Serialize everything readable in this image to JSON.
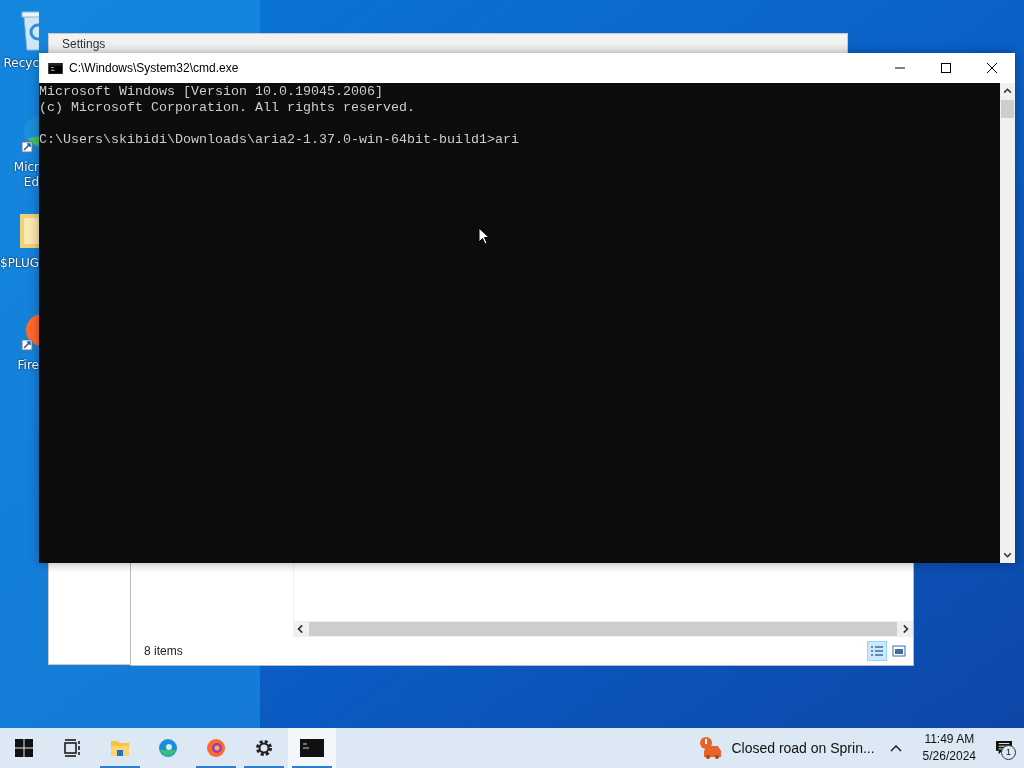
{
  "desktop_icons": [
    {
      "kind": "recycle",
      "label_lines": [
        "Recyc"
      ]
    },
    {
      "kind": "edge",
      "label_lines": [
        "Micr",
        "Ed"
      ]
    },
    {
      "kind": "folder",
      "label_lines": [
        "$PLUG"
      ]
    },
    {
      "kind": "firefox",
      "label_lines": [
        "Fire"
      ]
    }
  ],
  "settings_window": {
    "title": "Settings"
  },
  "explorer_window": {
    "status": "8 items",
    "views": [
      {
        "kind": "details",
        "selected": true
      },
      {
        "kind": "large",
        "selected": false
      }
    ]
  },
  "cmd_window": {
    "title": "C:\\Windows\\System32\\cmd.exe",
    "banner": [
      "Microsoft Windows [Version 10.0.19045.2006]",
      "(c) Microsoft Corporation. All rights reserved."
    ],
    "prompt": "C:\\Users\\skibidi\\Downloads\\aria2-1.37.0-win-64bit-build1>ari"
  },
  "taskbar": {
    "apps": [
      {
        "kind": "start",
        "running": false,
        "active": false
      },
      {
        "kind": "taskview",
        "running": false,
        "active": false
      },
      {
        "kind": "explorer",
        "running": true,
        "active": false
      },
      {
        "kind": "edge",
        "running": false,
        "active": false
      },
      {
        "kind": "firefox",
        "running": true,
        "active": false
      },
      {
        "kind": "settings",
        "running": true,
        "active": false
      },
      {
        "kind": "cmd",
        "running": true,
        "active": true
      }
    ],
    "notification": "Closed road on Sprin...",
    "time": "11:49 AM",
    "date": "5/26/2024",
    "action_center_badge": "1"
  }
}
